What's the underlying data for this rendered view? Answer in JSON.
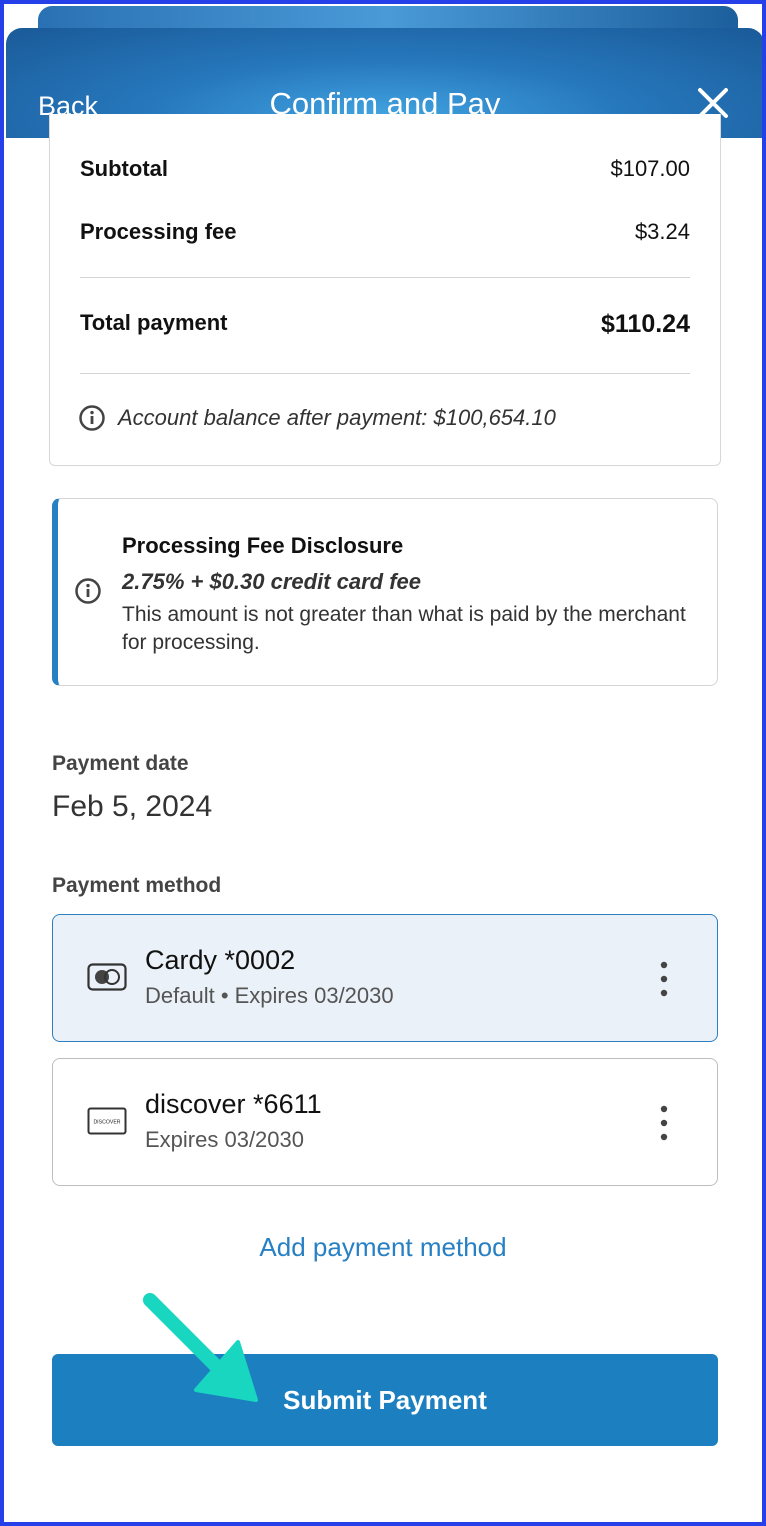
{
  "header": {
    "back_label": "Back",
    "title": "Confirm and Pay",
    "close_icon": "close-icon"
  },
  "summary": {
    "subtotal_label": "Subtotal",
    "subtotal_value": "$107.00",
    "fee_label": "Processing fee",
    "fee_value": "$3.24",
    "total_label": "Total payment",
    "total_value": "$110.24",
    "balance_text": "Account balance after payment: $100,654.10"
  },
  "disclosure": {
    "title": "Processing Fee Disclosure",
    "fee_text": "2.75% + $0.30 credit card fee",
    "body": "This amount is not greater than what is paid by the merchant for processing."
  },
  "payment_date": {
    "label": "Payment date",
    "value": "Feb 5, 2024"
  },
  "payment_method": {
    "label": "Payment method",
    "methods": [
      {
        "name": "Cardy *0002",
        "sub": "Default • Expires 03/2030",
        "icon": "card-toggle-icon",
        "selected": true
      },
      {
        "name": "discover *6611",
        "sub": "Expires 03/2030",
        "icon": "discover-card-icon",
        "selected": false
      }
    ],
    "add_label": "Add payment method"
  },
  "submit_label": "Submit Payment",
  "colors": {
    "accent": "#1c80c0",
    "link": "#2780c4",
    "selected_bg": "#eaf1f8",
    "annotation_arrow": "#19d6c0"
  }
}
